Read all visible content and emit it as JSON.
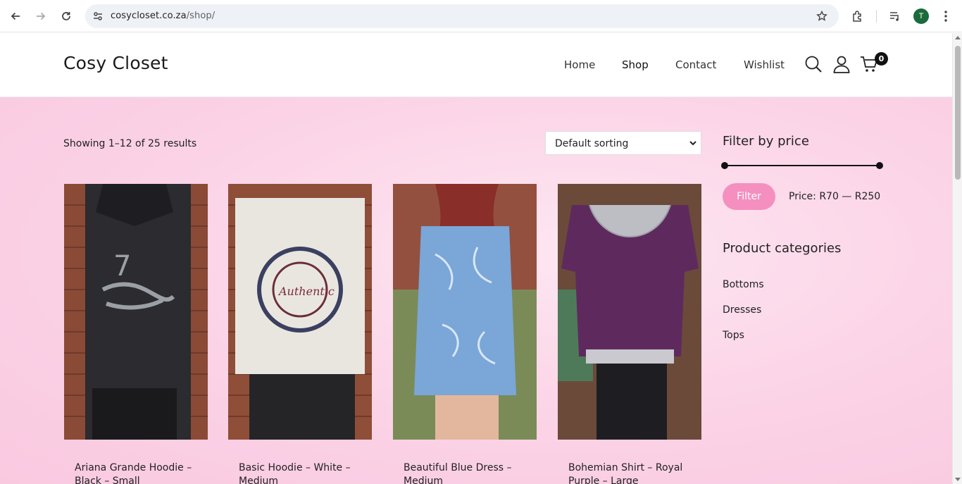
{
  "browser": {
    "url_host": "cosycloset.co.za",
    "url_path": "/shop/",
    "profile_initial": "T"
  },
  "site": {
    "logo": "Cosy Closet",
    "menu": [
      {
        "label": "Home",
        "active": false
      },
      {
        "label": "Shop",
        "active": true
      },
      {
        "label": "Contact",
        "active": false
      },
      {
        "label": "Wishlist",
        "active": false
      }
    ],
    "icons": [
      "search-icon",
      "account-icon",
      "cart-icon"
    ],
    "cart_count": "0"
  },
  "shop": {
    "results_text": "Showing 1–12 of 25 results",
    "sorting_selected": "Default sorting",
    "products": [
      {
        "title": "Ariana Grande Hoodie – Black – Small",
        "image": "black hoodie with graphic print"
      },
      {
        "title": "Basic Hoodie – White – Medium",
        "image": "white sweatshirt with circular print"
      },
      {
        "title": "Beautiful Blue Dress – Medium",
        "image": "blue leaf print dress"
      },
      {
        "title": "Bohemian Shirt – Royal Purple – Large",
        "image": "purple top with lace collar"
      }
    ]
  },
  "sidebar": {
    "price_title": "Filter by price",
    "filter_button": "Filter",
    "price_label": "Price: R70 — R250",
    "categories_title": "Product categories",
    "categories": [
      "Bottoms",
      "Dresses",
      "Tops"
    ]
  },
  "colors": {
    "accent_pink": "#f58fbf",
    "background_pink": "#fbd2e6"
  }
}
